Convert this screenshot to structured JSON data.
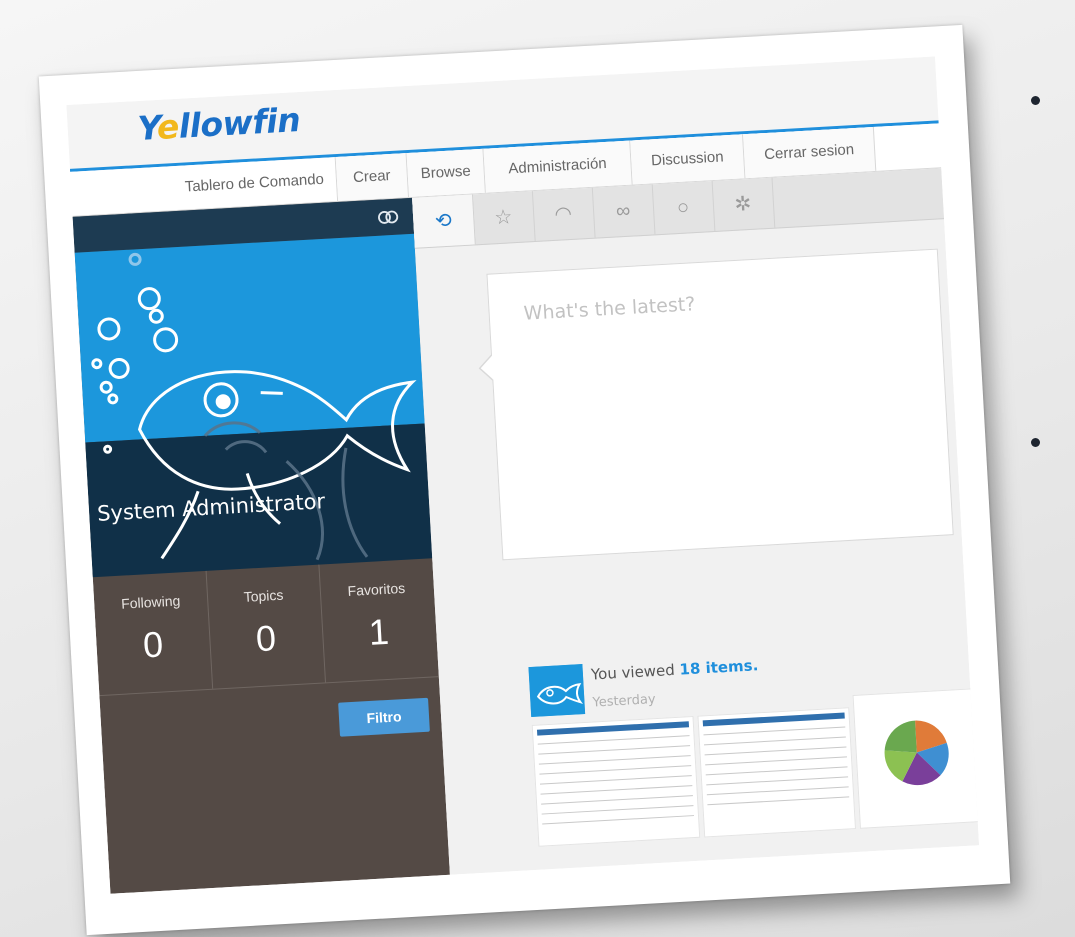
{
  "app": {
    "logo_prefix": "Y",
    "logo_o": "e",
    "logo_rest": "llowfin",
    "brand_blue": "#1f8fdc",
    "brand_yellow": "#f2b81c"
  },
  "nav": {
    "tabs": [
      {
        "label": "Tablero de Comando"
      },
      {
        "label": "Crear"
      },
      {
        "label": "Browse"
      },
      {
        "label": "Administración"
      },
      {
        "label": "Discussion"
      },
      {
        "label": "Cerrar sesion"
      }
    ]
  },
  "profile": {
    "name": "System Administrator",
    "stats": [
      {
        "label": "Following",
        "value": "0"
      },
      {
        "label": "Topics",
        "value": "0"
      },
      {
        "label": "Favoritos",
        "value": "1"
      }
    ],
    "filter_button": "Filtro"
  },
  "icon_tabs": [
    {
      "icon": "recent-icon",
      "glyph": "⟲",
      "active": true
    },
    {
      "icon": "star-icon",
      "glyph": "☆",
      "active": false
    },
    {
      "icon": "rss-icon",
      "glyph": "◠",
      "active": false
    },
    {
      "icon": "link-icon",
      "glyph": "∞",
      "active": false
    },
    {
      "icon": "comment-icon",
      "glyph": "○",
      "active": false
    },
    {
      "icon": "gear-icon",
      "glyph": "✲",
      "active": false
    }
  ],
  "post": {
    "placeholder": "What's the latest?"
  },
  "activity": {
    "prefix": "You viewed ",
    "count": "18 items.",
    "when": "Yesterday"
  }
}
